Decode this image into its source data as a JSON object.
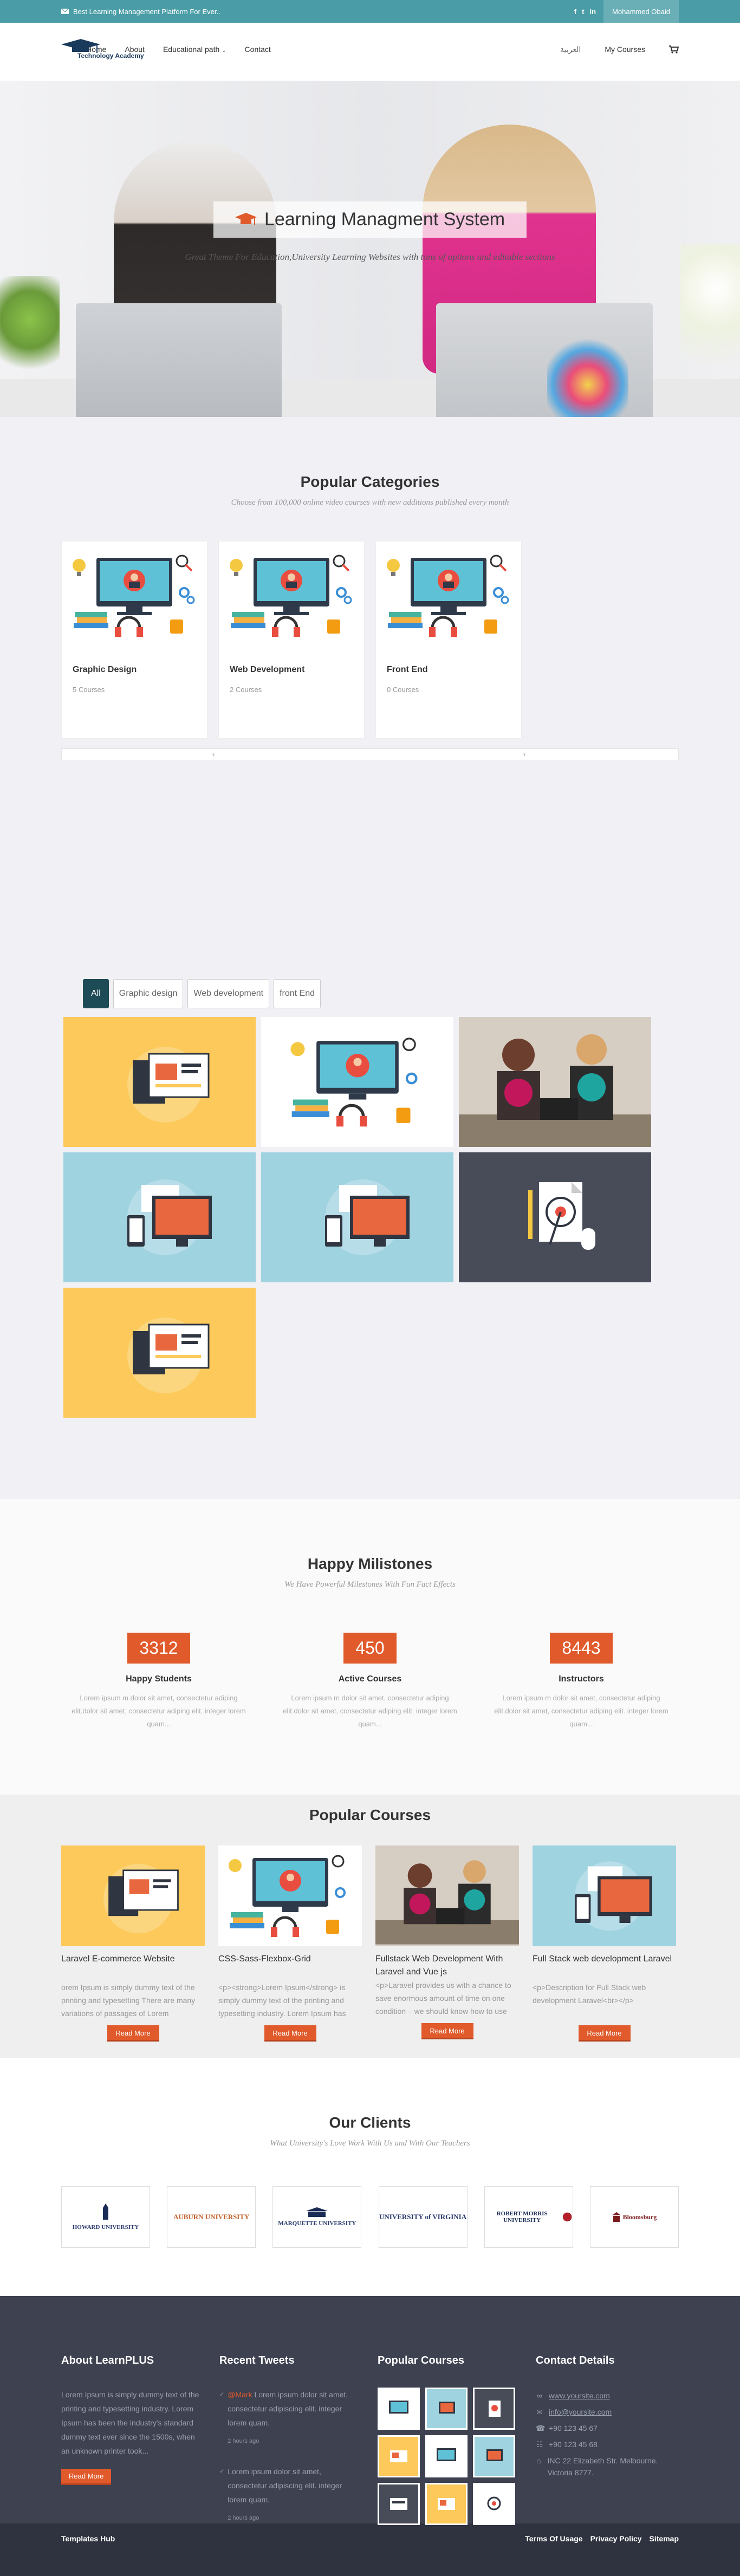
{
  "topbar": {
    "tagline": "Best Learning Management Platform For Ever..",
    "social": [
      "f",
      "t",
      "in"
    ],
    "user_name": "Mohammed Obaid"
  },
  "nav": {
    "logo_text": "Technology Academy",
    "menu": [
      "Home",
      "About",
      "Educational path",
      "Contact"
    ],
    "language": "العربية",
    "my_courses": "My Courses"
  },
  "hero": {
    "title": "Learning Managment System",
    "subtitle": "Great Theme For Education,University Learning Websites with tons of options and editable sections"
  },
  "categories": {
    "title": "Popular Categories",
    "subtitle": "Choose from 100,000 online video courses with new additions published every month",
    "items": [
      {
        "name": "Graphic Design",
        "count": "5 Courses"
      },
      {
        "name": "Web Development",
        "count": "2 Courses"
      },
      {
        "name": "Front End",
        "count": "0 Courses"
      }
    ]
  },
  "gallery": {
    "filters": [
      "All",
      "Graphic design",
      "Web development",
      "front End"
    ]
  },
  "milestones": {
    "title": "Happy Milistones",
    "subtitle": "We Have Powerful Milestones With Fun Fact Effects",
    "stats": [
      {
        "value": "3312",
        "label": "Happy Students",
        "desc": "Lorem ipsum m dolor sit amet, consectetur adiping elit.dolor sit amet, consectetur adiping elit. integer lorem quam..."
      },
      {
        "value": "450",
        "label": "Active Courses",
        "desc": "Lorem ipsum m dolor sit amet, consectetur adiping elit.dolor sit amet, consectetur adiping elit. integer lorem quam..."
      },
      {
        "value": "8443",
        "label": "Instructors",
        "desc": "Lorem ipsum m dolor sit amet, consectetur adiping elit.dolor sit amet, consectetur adiping elit. integer lorem quam..."
      }
    ]
  },
  "courses": {
    "title": "Popular Courses",
    "read_more": "Read More",
    "items": [
      {
        "title": "Laravel E-commerce Website",
        "desc": "orem Ipsum is simply dummy text of the printing and typesetting There are many variations of passages of Lorem"
      },
      {
        "title": "CSS-Sass-Flexbox-Grid",
        "desc": "<p><strong>Lorem Ipsum</strong> is simply dummy text of the printing and typesetting industry. Lorem Ipsum has"
      },
      {
        "title": "Fullstack Web Development With Laravel and Vue js",
        "desc": "<p>Laravel provides us with a chance to save enormous amount of time on one condition – we should know how to use"
      },
      {
        "title": "Full Stack web development Laravel",
        "desc": "<p>Description for Full Stack web development Laravel<br></p>"
      }
    ]
  },
  "clients": {
    "title": "Our Clients",
    "subtitle": "What University's Love Work With Us and With Our Teachers",
    "logos": [
      "HOWARD UNIVERSITY",
      "AUBURN UNIVERSITY",
      "MARQUETTE UNIVERSITY",
      "UNIVERSITY of VIRGINIA",
      "ROBERT MORRIS UNIVERSITY",
      "Bloomsburg"
    ]
  },
  "footer": {
    "about_title": "About LearnPLUS",
    "about_text": "Lorem Ipsum is simply dummy text of the printing and typesetting industry. Lorem Ipsum has been the industry's standard dummy text ever since the 1500s, when an unknown printer took...",
    "about_button": "Read More",
    "tweets_title": "Recent Tweets",
    "tweets": [
      {
        "name": "@Mark",
        "text": "Lorem ipsum dolor sit amet, consectetur adipiscing elit. integer lorem quam.",
        "time": "2 hours ago"
      },
      {
        "name": "",
        "text": "Lorem ipsum dolor sit amet, consectetur adipiscing elit. integer lorem quam.",
        "time": "2 hours ago"
      }
    ],
    "popular_title": "Popular Courses",
    "contact_title": "Contact Details",
    "contact": {
      "website": "www.yoursite.com",
      "email": "info@yoursite.com",
      "phone": "+90 123 45 67",
      "fax": "+90 123 45 68",
      "address": "INC 22 Elizabeth Str. Melbourne. Victoria 8777."
    }
  },
  "bottombar": {
    "left": "Templates Hub",
    "links": [
      "Terms Of Usage",
      "Privacy Policy",
      "Sitemap"
    ]
  },
  "colors": {
    "topbar": "#4a9da6",
    "accent": "#e05a2b",
    "filter_active": "#1d4b56",
    "footer": "#3d4150"
  }
}
